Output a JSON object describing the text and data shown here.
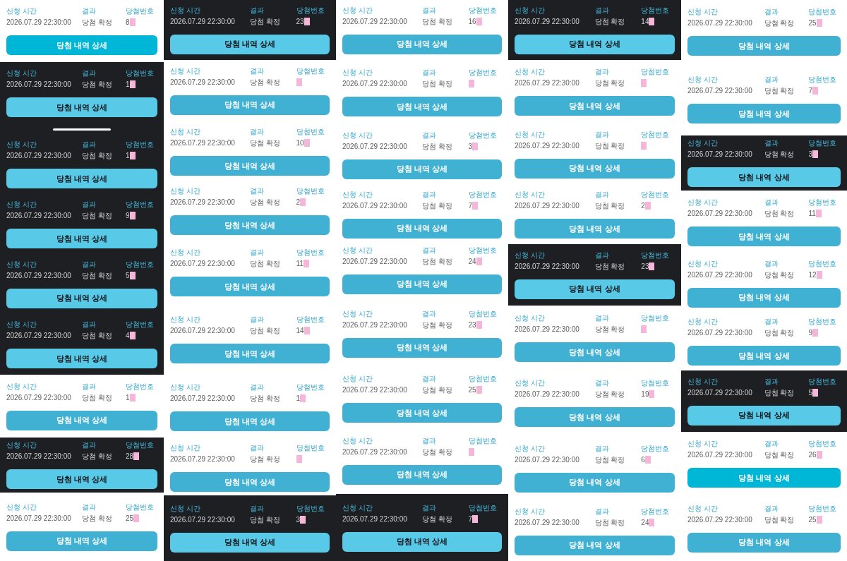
{
  "columns": [
    {
      "tiles": [
        {
          "kind": "vivid",
          "home_indicator": false,
          "cards": [
            {
              "time_label": "신청 시간",
              "time": "2026.07.29 22:30:00",
              "result_label": "결과",
              "result": "당첨 확정",
              "number_label": "당첨번호",
              "number": "8",
              "redacted": true,
              "button": "당첨 내역 상세"
            }
          ]
        },
        {
          "kind": "dark",
          "home_indicator": true,
          "cards": [
            {
              "time_label": "신청 시간",
              "time": "2026.07.29 22:30:00",
              "result_label": "결과",
              "result": "당첨 확정",
              "number_label": "당첨번호",
              "number": "1",
              "redacted": true,
              "button": "당첨 내역 상세"
            }
          ]
        },
        {
          "kind": "dark",
          "home_indicator": false,
          "cards": [
            {
              "time_label": "신청 시간",
              "time": "2026.07.29 22:30:00",
              "result_label": "결과",
              "result": "당첨 확정",
              "number_label": "당첨번호",
              "number": "1",
              "redacted": true,
              "button": "당첨 내역 상세"
            },
            {
              "time_label": "신청 시간",
              "time": "2026.07.29 22:30:00",
              "result_label": "결과",
              "result": "당첨 확정",
              "number_label": "당첨번호",
              "number": "9",
              "redacted": true,
              "button": "당첨 내역 상세"
            }
          ]
        },
        {
          "kind": "dark",
          "home_indicator": false,
          "cards": [
            {
              "time_label": "신청 시간",
              "time": "2026.07.29 22:30:00",
              "result_label": "결과",
              "result": "당첨 확정",
              "number_label": "당첨번호",
              "number": "5",
              "redacted": true,
              "button": "당첨 내역 상세"
            },
            {
              "time_label": "신청 시간",
              "time": "2026.07.29 22:30:00",
              "result_label": "결과",
              "result": "당첨 확정",
              "number_label": "당첨번호",
              "number": "4",
              "redacted": true,
              "button": "당첨 내역 상세"
            }
          ]
        },
        {
          "kind": "light",
          "home_indicator": false,
          "cards": [
            {
              "time_label": "신청 시간",
              "time": "2026.07.29 22:30:00",
              "result_label": "결과",
              "result": "당첨 확정",
              "number_label": "당첨번호",
              "number": "1",
              "redacted": true,
              "button": "당첨 내역 상세"
            }
          ]
        },
        {
          "kind": "dark",
          "home_indicator": false,
          "cards": [
            {
              "time_label": "신청 시간",
              "time": "2026.07.29 22:30:00",
              "result_label": "결과",
              "result": "당첨 확정",
              "number_label": "당첨번호",
              "number": "28",
              "redacted": true,
              "button": "당첨 내역 상세"
            }
          ]
        },
        {
          "kind": "light",
          "home_indicator": false,
          "cards": [
            {
              "time_label": "신청 시간",
              "time": "2026.07.29 22:30:00",
              "result_label": "결과",
              "result": "당첨 확정",
              "number_label": "당첨번호",
              "number": "25",
              "redacted": true,
              "button": "당첨 내역 상세"
            }
          ]
        }
      ]
    },
    {
      "tiles": [
        {
          "kind": "dark",
          "home_indicator": false,
          "cards": [
            {
              "time_label": "신청 시간",
              "time": "2026.07.29 22:30:00",
              "result_label": "결과",
              "result": "당첨 확정",
              "number_label": "당첨번호",
              "number": "23",
              "redacted": true,
              "button": "당첨 내역 상세"
            }
          ]
        },
        {
          "kind": "light",
          "home_indicator": false,
          "cards": [
            {
              "time_label": "신청 시간",
              "time": "2026.07.29 22:30:00",
              "result_label": "결과",
              "result": "당첨 확정",
              "number_label": "당첨번호",
              "redacted": true,
              "button": "당첨 내역 상세"
            },
            {
              "time_label": "신청 시간",
              "time": "2026.07.29 22:30:00",
              "result_label": "결과",
              "result": "당첨 확정",
              "number_label": "당첨번호",
              "number": "10",
              "redacted": true,
              "button": "당첨 내역 상세"
            },
            {
              "time_label": "신청 시간",
              "time": "2026.07.29 22:30:00",
              "result_label": "결과",
              "result": "당첨 확정",
              "number_label": "당첨번호",
              "number": "2",
              "redacted": true,
              "button": "당첨 내역 상세"
            },
            {
              "time_label": "신청 시간",
              "time": "2026.07.29 22:30:00",
              "result_label": "결과",
              "result": "당첨 확정",
              "number_label": "당첨번호",
              "number": "11",
              "redacted": true,
              "button": "당첨 내역 상세"
            },
            {
              "time_label": "신청 시간",
              "time": "2026.07.29 22:30:00",
              "result_label": "결과",
              "result": "당첨 확정",
              "number_label": "당첨번호",
              "number": "14",
              "redacted": true,
              "button": "당첨 내역 상세"
            }
          ]
        },
        {
          "kind": "light",
          "home_indicator": false,
          "cards": [
            {
              "time_label": "신청 시간",
              "time": "2026.07.29 22:30:00",
              "result_label": "결과",
              "result": "당첨 확정",
              "number_label": "당첨번호",
              "number": "1",
              "redacted": true,
              "button": "당첨 내역 상세"
            },
            {
              "time_label": "신청 시간",
              "time": "2026.07.29 22:30:00",
              "result_label": "결과",
              "result": "당첨 확정",
              "number_label": "당첨번호",
              "redacted": true,
              "button": "당첨 내역 상세"
            }
          ]
        },
        {
          "kind": "dark",
          "home_indicator": false,
          "cards": [
            {
              "time_label": "신청 시간",
              "time": "2026.07.29 22:30:00",
              "result_label": "결과",
              "result": "당첨 확정",
              "number_label": "당첨번호",
              "number": "3",
              "redacted": true,
              "button": "당첨 내역 상세"
            }
          ]
        }
      ]
    },
    {
      "tiles": [
        {
          "kind": "light",
          "home_indicator": false,
          "cards": [
            {
              "time_label": "신청 시간",
              "time": "2026.07.29 22:30:00",
              "result_label": "결과",
              "result": "당첨 확정",
              "number_label": "당첨번호",
              "number": "16",
              "redacted": true,
              "button": "당첨 내역 상세"
            }
          ]
        },
        {
          "kind": "light",
          "home_indicator": false,
          "cards": [
            {
              "time_label": "신청 시간",
              "time": "2026.07.29 22:30:00",
              "result_label": "결과",
              "result": "당첨 확정",
              "number_label": "당첨번호",
              "redacted": true,
              "button": "당첨 내역 상세"
            },
            {
              "time_label": "신청 시간",
              "time": "2026.07.29 22:30:00",
              "result_label": "결과",
              "result": "당첨 확정",
              "number_label": "당첨번호",
              "number": "3",
              "redacted": true,
              "button": "당첨 내역 상세"
            },
            {
              "time_label": "신청 시간",
              "time": "2026.07.29 22:30:00",
              "result_label": "결과",
              "result": "당첨 확정",
              "number_label": "당첨번호",
              "number": "7",
              "redacted": true,
              "button": "당첨 내역 상세"
            },
            {
              "time_label": "신청 시간",
              "time": "2026.07.29 22:30:00",
              "result_label": "결과",
              "result": "당첨 확정",
              "number_label": "당첨번호",
              "number": "24",
              "redacted": true,
              "button": "당첨 내역 상세"
            }
          ]
        },
        {
          "kind": "light",
          "home_indicator": false,
          "cards": [
            {
              "time_label": "신청 시간",
              "time": "2026.07.29 22:30:00",
              "result_label": "결과",
              "result": "당첨 확정",
              "number_label": "당첨번호",
              "number": "23",
              "redacted": true,
              "button": "당첨 내역 상세"
            },
            {
              "time_label": "신청 시간",
              "time": "2026.07.29 22:30:00",
              "result_label": "결과",
              "result": "당첨 확정",
              "number_label": "당첨번호",
              "number": "25",
              "redacted": true,
              "button": "당첨 내역 상세"
            },
            {
              "time_label": "신청 시간",
              "time": "2026.07.29 22:30:00",
              "result_label": "결과",
              "result": "당첨 확정",
              "number_label": "당첨번호",
              "redacted": true,
              "button": "당첨 내역 상세"
            }
          ]
        },
        {
          "kind": "dark",
          "home_indicator": false,
          "cards": [
            {
              "time_label": "신청 시간",
              "time": "2026.07.29 22:30:00",
              "result_label": "결과",
              "result": "당첨 확정",
              "number_label": "당첨번호",
              "number": "7",
              "redacted": true,
              "button": "당첨 내역 상세"
            }
          ]
        }
      ]
    },
    {
      "tiles": [
        {
          "kind": "dark",
          "home_indicator": false,
          "cards": [
            {
              "time_label": "신청 시간",
              "time": "2026.07.29 22:30:00",
              "result_label": "결과",
              "result": "당첨 확정",
              "number_label": "당첨번호",
              "number": "14",
              "redacted": true,
              "button": "당첨 내역 상세"
            }
          ]
        },
        {
          "kind": "light",
          "home_indicator": false,
          "cards": [
            {
              "time_label": "신청 시간",
              "time": "2026.07.29 22:30:00",
              "result_label": "결과",
              "result": "당첨 확정",
              "number_label": "당첨번호",
              "redacted": true,
              "button": "당첨 내역 상세"
            },
            {
              "time_label": "신청 시간",
              "time": "2026.07.29 22:30:00",
              "result_label": "결과",
              "result": "당첨 확정",
              "number_label": "당첨번호",
              "redacted": true,
              "button": "당첨 내역 상세"
            },
            {
              "time_label": "신청 시간",
              "time": "2026.07.29 22:30:00",
              "result_label": "결과",
              "result": "당첨 확정",
              "number_label": "당첨번호",
              "number": "2",
              "redacted": true,
              "button": "당첨 내역 상세"
            }
          ]
        },
        {
          "kind": "dark",
          "home_indicator": false,
          "cards": [
            {
              "time_label": "신청 시간",
              "time": "2026.07.29 22:30:00",
              "result_label": "결과",
              "result": "당첨 확정",
              "number_label": "당첨번호",
              "number": "23",
              "redacted": true,
              "button": "당첨 내역 상세"
            }
          ]
        },
        {
          "kind": "light",
          "home_indicator": false,
          "cards": [
            {
              "time_label": "신청 시간",
              "time": "2026.07.29 22:30:00",
              "result_label": "결과",
              "result": "당첨 확정",
              "number_label": "당첨번호",
              "redacted": true,
              "button": "당첨 내역 상세"
            },
            {
              "time_label": "신청 시간",
              "time": "2026.07.29 22:30:00",
              "result_label": "결과",
              "result": "당첨 확정",
              "number_label": "당첨번호",
              "number": "19",
              "redacted": true,
              "button": "당첨 내역 상세"
            },
            {
              "time_label": "신청 시간",
              "time": "2026.07.29 22:30:00",
              "result_label": "결과",
              "result": "당첨 확정",
              "number_label": "당첨번호",
              "number": "6",
              "redacted": true,
              "button": "당첨 내역 상세"
            },
            {
              "time_label": "신청 시간",
              "time": "2026.07.29 22:30:00",
              "result_label": "결과",
              "result": "당첨 확정",
              "number_label": "당첨번호",
              "number": "24",
              "redacted": true,
              "button": "당첨 내역 상세"
            }
          ]
        }
      ]
    },
    {
      "tiles": [
        {
          "kind": "light",
          "home_indicator": false,
          "cards": [
            {
              "time_label": "신청 시간",
              "time": "2026.07.29 22:30:00",
              "result_label": "결과",
              "result": "당첨 확정",
              "number_label": "당첨번호",
              "number": "25",
              "redacted": true,
              "button": "당첨 내역 상세"
            },
            {
              "time_label": "신청 시간",
              "time": "2026.07.29 22:30:00",
              "result_label": "결과",
              "result": "당첨 확정",
              "number_label": "당첨번호",
              "number": "7",
              "redacted": true,
              "button": "당첨 내역 상세"
            }
          ]
        },
        {
          "kind": "dark",
          "home_indicator": false,
          "cards": [
            {
              "time_label": "신청 시간",
              "time": "2026.07.29 22:30:00",
              "result_label": "결과",
              "result": "당첨 확정",
              "number_label": "당첨번호",
              "number": "3",
              "redacted": true,
              "button": "당첨 내역 상세"
            }
          ]
        },
        {
          "kind": "light",
          "home_indicator": false,
          "cards": [
            {
              "time_label": "신청 시간",
              "time": "2026.07.29 22:30:00",
              "result_label": "결과",
              "result": "당첨 확정",
              "number_label": "당첨번호",
              "number": "11",
              "redacted": true,
              "button": "당첨 내역 상세"
            },
            {
              "time_label": "신청 시간",
              "time": "2026.07.29 22:30:00",
              "result_label": "결과",
              "result": "당첨 확정",
              "number_label": "당첨번호",
              "number": "12",
              "redacted": true,
              "button": "당첨 내역 상세"
            },
            {
              "time_label": "신청 시간",
              "time": "2026.07.29 22:30:00",
              "result_label": "결과",
              "result": "당첨 확정",
              "number_label": "당첨번호",
              "number": "9",
              "redacted": true,
              "button": "당첨 내역 상세"
            }
          ]
        },
        {
          "kind": "dark",
          "home_indicator": false,
          "cards": [
            {
              "time_label": "신청 시간",
              "time": "2026.07.29 22:30:00",
              "result_label": "결과",
              "result": "당첨 확정",
              "number_label": "당첨번호",
              "number": "5",
              "redacted": true,
              "button": "당첨 내역 상세"
            }
          ]
        },
        {
          "kind": "vivid",
          "home_indicator": false,
          "cards": [
            {
              "time_label": "신청 시간",
              "time": "2026.07.29 22:30:00",
              "result_label": "결과",
              "result": "당첨 확정",
              "number_label": "당첨번호",
              "number": "26",
              "redacted": true,
              "button": "당첨 내역 상세"
            }
          ]
        },
        {
          "kind": "light",
          "home_indicator": false,
          "cards": [
            {
              "time_label": "신청 시간",
              "time": "2026.07.29 22:30:00",
              "result_label": "결과",
              "result": "당첨 확정",
              "number_label": "당첨번호",
              "number": "25",
              "redacted": true,
              "button": "당첨 내역 상세"
            }
          ]
        }
      ]
    }
  ]
}
